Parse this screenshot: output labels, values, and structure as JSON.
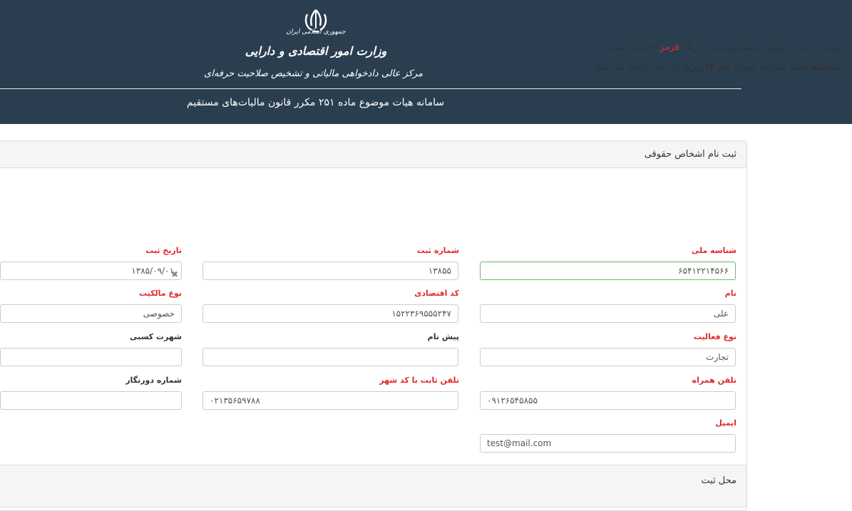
{
  "header": {
    "emblem_icon": "iran-emblem-icon",
    "logo_line_1": "جمهوری اسلامی ایران",
    "logo_line_2": "وزارت امور اقتصادی و دارایی",
    "logo_line_3": "مرکز عالی دادخواهی مالیاتی و تشخیص صلاحیت حرفه‌ای",
    "system_title": "سامانه هیات موضوع ماده ۲۵۱ مکرر قانون مالیات‌های مستقیم",
    "background_color": "#2b3e50"
  },
  "panel": {
    "title": "ثبت نام اشخاص حقوقی",
    "note1_prefix": "توجه: پر کردن موارد مشخص شده با رنگ",
    "note1_red": "قرمز",
    "note1_suffix": "اجباری است.",
    "note2_bold1": "شناسه ملی",
    "note2_mid": "شما به عنوان",
    "note2_bold2": "نام کاربری",
    "note2_suffix": "در نظر گرفته می شود."
  },
  "form": {
    "national_id": {
      "label": "شناسه ملی",
      "value": "۶۵۴۱۲۲۱۴۵۶۶"
    },
    "reg_number": {
      "label": "شماره ثبت",
      "value": "۱۳۸۵۵"
    },
    "reg_date": {
      "label": "تاریخ ثبت",
      "value": "۱۳۸۵/۰۹/۰۱"
    },
    "name": {
      "label": "نام",
      "value": "علی"
    },
    "economic_code": {
      "label": "کد اقتصادی",
      "value": "۱۵۲۲۳۶۹۵۵۵۲۴۷"
    },
    "ownership_type": {
      "label": "نوع مالکیت",
      "value": "خصوصی"
    },
    "activity_type": {
      "label": "نوع فعالیت",
      "value": "تجارت"
    },
    "prefix_name": {
      "label": "پیش نام",
      "value": ""
    },
    "business_fame": {
      "label": "شهرت کسبی",
      "value": ""
    },
    "mobile": {
      "label": "تلفن همراه",
      "value": "۰۹۱۲۶۵۴۵۸۵۵"
    },
    "landline": {
      "label": "تلفن ثابت با کد شهر",
      "value": "۰۲۱۳۵۶۵۹۷۸۸"
    },
    "fax": {
      "label": "شماره دورنگار",
      "value": ""
    },
    "email": {
      "label": "ایمیل",
      "value": "test@mail.com"
    }
  },
  "section2": {
    "title": "محل ثبت"
  },
  "colors": {
    "required_label": "#e0292c",
    "focused_border": "#66bb6a"
  }
}
